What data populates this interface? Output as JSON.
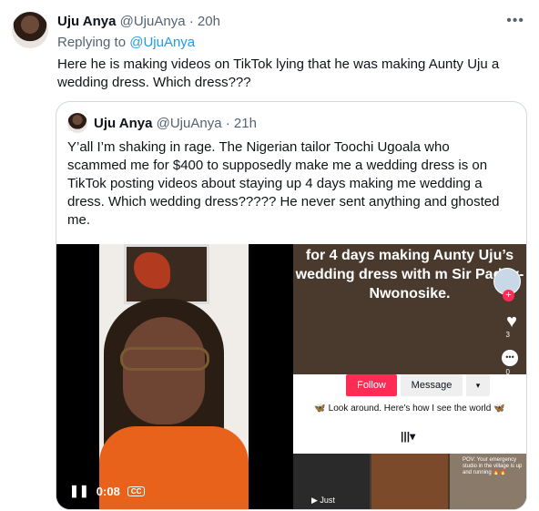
{
  "tweet": {
    "name": "Uju Anya",
    "handle": "@UjuAnya",
    "time": "· 20h",
    "replying_prefix": "Replying to",
    "replying_to": "@UjuAnya",
    "text": "Here he is making videos on TikTok lying that he was making Aunty Uju a wedding dress. Which dress???",
    "more_icon": "•••"
  },
  "quote": {
    "name": "Uju Anya",
    "handle": "@UjuAnya",
    "time": "· 21h",
    "text": "Y’all I’m shaking in rage. The Nigerian tailor Toochi Ugoala who scammed me for $400 to supposedly make me a wedding dress is on TikTok posting videos about staying up 4 days making me wedding a dress. Which wedding dress????? He never sent anything and ghosted me."
  },
  "video": {
    "time": "0:08",
    "cc": "CC",
    "pause_icon": "❚❚"
  },
  "tiktok": {
    "overlay_text": "for 4 days making Aunty Uju’s wedding dress with m Sir Paddy-Nwonosike.",
    "like_count": "3",
    "comment_count": "0",
    "follow_label": "Follow",
    "message_label": "Message",
    "dropdown_icon": "▾",
    "bio": "🦋 Look around. Here's how I see the world 🦋",
    "tab_icon": "|||▾",
    "thumb1_caption": "▶ Just",
    "thumb3_caption": "POV: Your emergency studio in the village is up and running 🔥🔥"
  }
}
